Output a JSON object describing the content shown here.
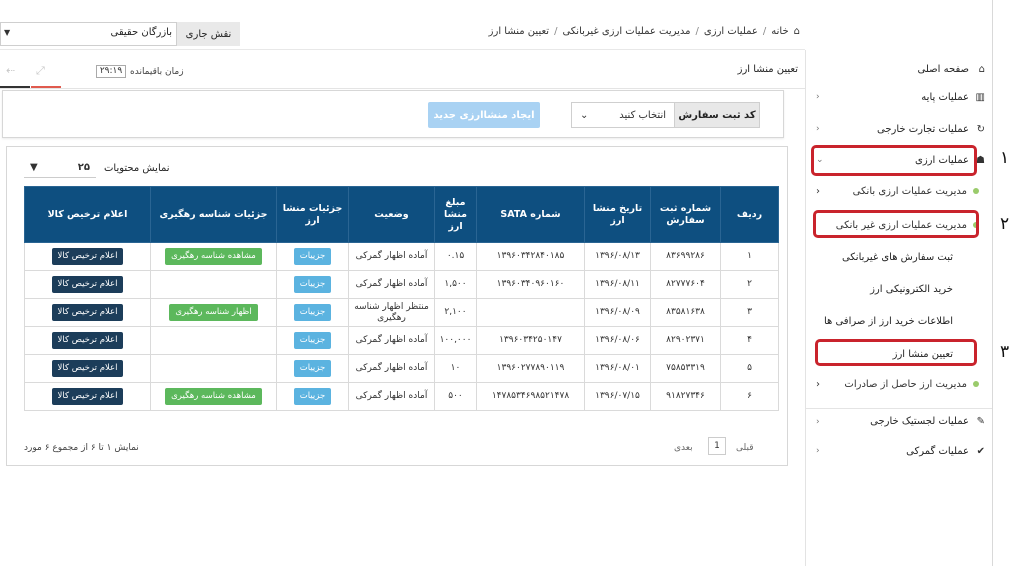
{
  "topbar": {
    "role_label": "نقش جاری",
    "role_value": "بازرگان حقیقی",
    "breadcrumb": [
      "خانه",
      "عملیات ارزی",
      "مدیریت عملیات ارزی غیربانکی",
      "تعیین منشا ارز"
    ]
  },
  "subheader": {
    "page_title": "تعیین منشا ارز",
    "timer_label": "زمان باقیمانده",
    "timer_value": "۲۹:۱۹"
  },
  "toolbar": {
    "order_label": "کد ثبت سفارش",
    "order_select": "انتخاب کنید",
    "new_button": "ایجاد منشاارزی جدید"
  },
  "grid": {
    "show_label": "نمایش محتویات",
    "show_value": "۲۵",
    "columns": [
      "ردیف",
      "شماره ثبت سفارش",
      "تاریخ منشا ارز",
      "شماره SATA",
      "مبلغ منشا ارز",
      "وضعیت",
      "جزئیات منشا ارز",
      "جزئیات شناسه رهگیری",
      "اعلام ترخیص کالا"
    ],
    "detail_btn": "جزییات",
    "view_track_btn": "مشاهده شناسه رهگیری",
    "show_track_btn": "اظهار شناسه رهگیری",
    "clear_btn": "اعلام ترخیص کالا",
    "rows": [
      {
        "idx": "۱",
        "order": "۸۳۶۹۹۲۸۶",
        "date": "۱۳۹۶/۰۸/۱۳",
        "sata": "۱۳۹۶۰۳۴۲۸۴۰۱۸۵",
        "amount": "۰.۱۵",
        "status": "آماده اظهار گمرکی",
        "track": "view"
      },
      {
        "idx": "۲",
        "order": "۸۲۷۷۷۶۰۴",
        "date": "۱۳۹۶/۰۸/۱۱",
        "sata": "۱۳۹۶۰۳۴۰۹۶۰۱۶۰",
        "amount": "۱,۵۰۰",
        "status": "آماده اظهار گمرکی",
        "track": "none"
      },
      {
        "idx": "۳",
        "order": "۸۳۵۸۱۶۳۸",
        "date": "۱۳۹۶/۰۸/۰۹",
        "sata": "",
        "amount": "۲,۱۰۰",
        "status": "منتظر اظهار شناسه رهگیری",
        "track": "show"
      },
      {
        "idx": "۴",
        "order": "۸۲۹۰۲۳۷۱",
        "date": "۱۳۹۶/۰۸/۰۶",
        "sata": "۱۳۹۶۰۳۴۲۵۰۱۴۷",
        "amount": "۱۰۰,۰۰۰",
        "status": "آماده اظهار گمرکی",
        "track": "none"
      },
      {
        "idx": "۵",
        "order": "۷۵۸۵۳۳۱۹",
        "date": "۱۳۹۶/۰۸/۰۱",
        "sata": "۱۳۹۶۰۲۷۷۸۹۰۱۱۹",
        "amount": "۱۰",
        "status": "آماده اظهار گمرکی",
        "track": "none"
      },
      {
        "idx": "۶",
        "order": "۹۱۸۲۷۳۴۶",
        "date": "۱۳۹۶/۰۷/۱۵",
        "sata": "۱۴۷۸۵۳۴۶۹۸۵۲۱۴۷۸",
        "amount": "۵۰۰",
        "status": "آماده اظهار گمرکی",
        "track": "view"
      }
    ]
  },
  "pager": {
    "prev": "قبلی",
    "page": "1",
    "next": "بعدی",
    "info": "نمایش ۱ تا ۶ از مجموع ۶ مورد"
  },
  "sidebar": {
    "items": [
      {
        "label": "صفحه اصلی",
        "icon": "home-icon",
        "glyph": "⌂"
      },
      {
        "label": "عملیات پایه",
        "icon": "chart-icon",
        "glyph": "▥"
      },
      {
        "label": "عملیات تجارت خارجی",
        "icon": "refresh-icon",
        "glyph": "↻"
      },
      {
        "label": "عملیات ارزی",
        "icon": "users-icon",
        "glyph": "☗"
      }
    ],
    "sub_items": [
      "مدیریت عملیات ارزی بانکی",
      "مدیریت عملیات ارزی غیر بانکی"
    ],
    "sub2_items": [
      "ثبت سفارش های غیربانکی",
      "خرید الکترونیکی ارز",
      "اطلاعات خرید ارز از صرافی ها",
      "تعیین منشا ارز"
    ],
    "sub_last": "مدیریت ارز حاصل از صادرات",
    "bottom_items": [
      {
        "label": "عملیات لجستیک خارجی",
        "icon": "edit-icon",
        "glyph": "✎"
      },
      {
        "label": "عملیات گمرکی",
        "icon": "check-icon",
        "glyph": "✔"
      }
    ]
  },
  "markers": [
    "۱",
    "۲",
    "۳"
  ],
  "colors": {
    "header": "#0e4f80",
    "accent_red": "#c9232c",
    "btn_blue": "#5bb3e0",
    "btn_green": "#5cb85c",
    "btn_dark": "#1c3d5a"
  }
}
